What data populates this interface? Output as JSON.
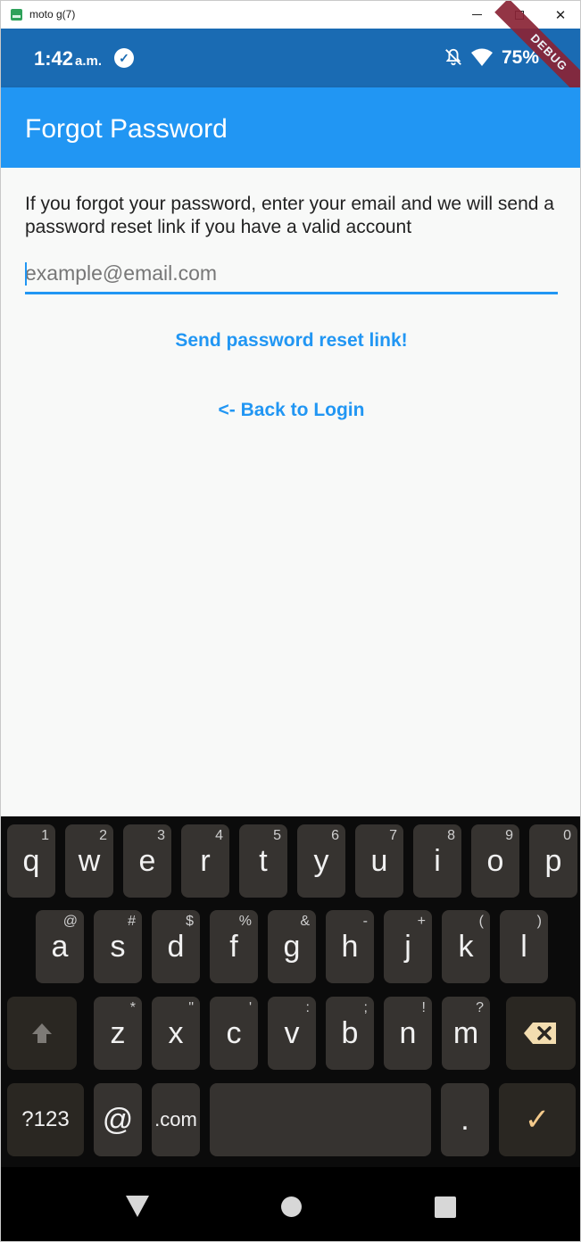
{
  "window": {
    "title": "moto g(7)"
  },
  "status_bar": {
    "time": "1:42",
    "ampm": "a.m.",
    "battery": "75%",
    "debug_label": "DEBUG"
  },
  "app_bar": {
    "title": "Forgot Password"
  },
  "content": {
    "info_text": "If you forgot your password, enter your email and we will send a password reset link if you have a valid account",
    "email_placeholder": "example@email.com",
    "email_value": "",
    "send_link_label": "Send password reset link!",
    "back_link_label": "<- Back to Login"
  },
  "keyboard": {
    "row1": [
      {
        "k": "q",
        "h": "1"
      },
      {
        "k": "w",
        "h": "2"
      },
      {
        "k": "e",
        "h": "3"
      },
      {
        "k": "r",
        "h": "4"
      },
      {
        "k": "t",
        "h": "5"
      },
      {
        "k": "y",
        "h": "6"
      },
      {
        "k": "u",
        "h": "7"
      },
      {
        "k": "i",
        "h": "8"
      },
      {
        "k": "o",
        "h": "9"
      },
      {
        "k": "p",
        "h": "0"
      }
    ],
    "row2": [
      {
        "k": "a",
        "h": "@"
      },
      {
        "k": "s",
        "h": "#"
      },
      {
        "k": "d",
        "h": "$"
      },
      {
        "k": "f",
        "h": "%"
      },
      {
        "k": "g",
        "h": "&"
      },
      {
        "k": "h",
        "h": "-"
      },
      {
        "k": "j",
        "h": "+"
      },
      {
        "k": "k",
        "h": "("
      },
      {
        "k": "l",
        "h": ")"
      }
    ],
    "row3": [
      {
        "k": "z",
        "h": "*"
      },
      {
        "k": "x",
        "h": "\""
      },
      {
        "k": "c",
        "h": "'"
      },
      {
        "k": "v",
        "h": ":"
      },
      {
        "k": "b",
        "h": ";"
      },
      {
        "k": "n",
        "h": "!"
      },
      {
        "k": "m",
        "h": "?"
      }
    ],
    "symbols_label": "?123",
    "at_label": "@",
    "com_label": ".com",
    "period_label": ".",
    "enter_label": "✓"
  }
}
